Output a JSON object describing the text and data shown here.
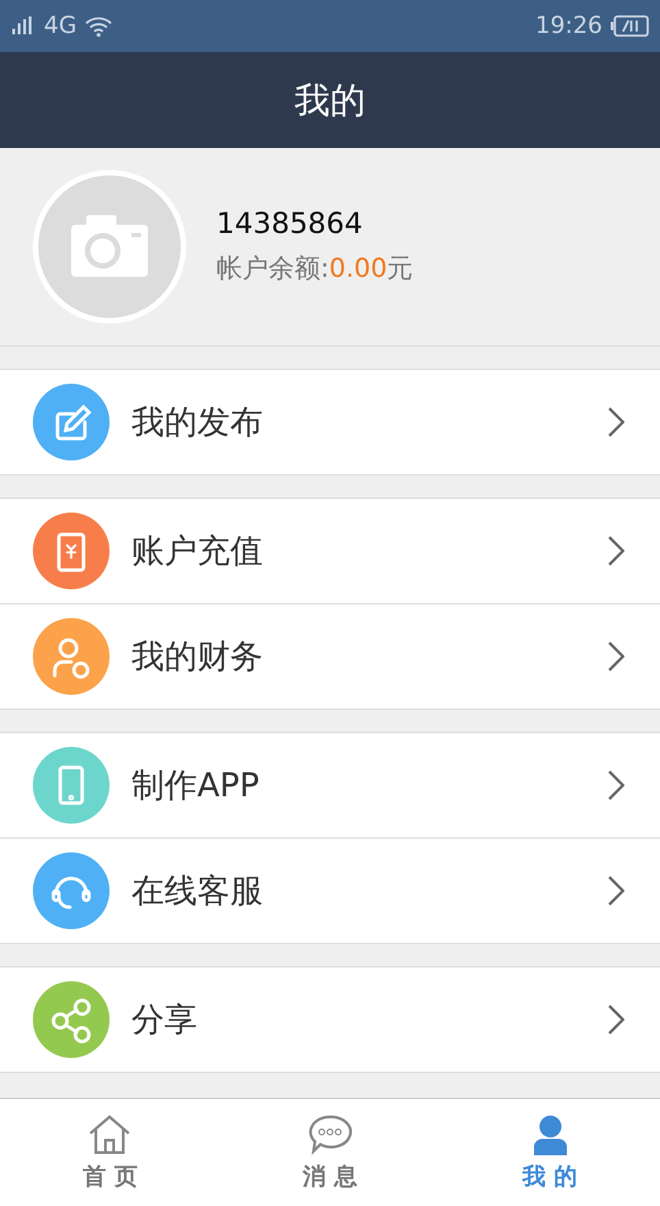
{
  "status_bar": {
    "network": "4G",
    "time": "19:26"
  },
  "header": {
    "title": "我的"
  },
  "profile": {
    "user_id": "14385864",
    "balance_label": "帐户余额:",
    "balance": "0.00",
    "currency": "元"
  },
  "menu_groups": [
    {
      "items": [
        {
          "kind": "edit",
          "label": "我的发布",
          "color": "#4fb0f5"
        }
      ]
    },
    {
      "items": [
        {
          "kind": "recharge",
          "label": "账户充值",
          "color": "#f77e4b"
        },
        {
          "kind": "finance",
          "label": "我的财务",
          "color": "#fba24b"
        }
      ]
    },
    {
      "items": [
        {
          "kind": "app",
          "label": "制作APP",
          "color": "#6dd6cc"
        },
        {
          "kind": "service",
          "label": "在线客服",
          "color": "#4fb0f5"
        }
      ]
    },
    {
      "items": [
        {
          "kind": "share",
          "label": "分享",
          "color": "#94c94f"
        }
      ]
    }
  ],
  "tab_bar": [
    {
      "kind": "home",
      "label": "首 页",
      "selected": false
    },
    {
      "kind": "messages",
      "label": "消 息",
      "selected": false
    },
    {
      "kind": "me",
      "label": "我 的",
      "selected": true
    }
  ]
}
